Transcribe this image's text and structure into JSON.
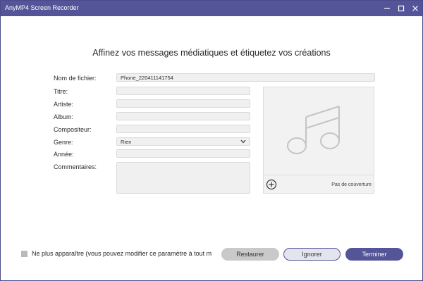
{
  "window": {
    "title": "AnyMP4 Screen Recorder"
  },
  "heading": "Affinez vos messages médiatiques et étiquetez vos créations",
  "fields": {
    "filename": {
      "label": "Nom de fichier:",
      "value": "Phone_220411141754"
    },
    "title": {
      "label": "Titre:",
      "value": ""
    },
    "artist": {
      "label": "Artiste:",
      "value": ""
    },
    "album": {
      "label": "Album:",
      "value": ""
    },
    "composer": {
      "label": "Compositeur:",
      "value": ""
    },
    "genre": {
      "label": "Genre:",
      "value": "Rien"
    },
    "year": {
      "label": "Année:",
      "value": ""
    },
    "comments": {
      "label": "Commentaires:",
      "value": ""
    }
  },
  "cover": {
    "no_cover_label": "Pas de couverture",
    "placeholder_icon": "music-note-icon",
    "add_icon": "plus-circle-icon"
  },
  "footer": {
    "dont_show_label": "Ne plus apparaître (vous pouvez modifier ce paramètre à tout m",
    "dont_show_checked": false,
    "buttons": {
      "restore": "Restaurer",
      "ignore": "Ignorer",
      "finish": "Terminer"
    }
  },
  "colors": {
    "titlebar": "#545598",
    "accent": "#545598",
    "field_bg": "#f0f0f0"
  }
}
